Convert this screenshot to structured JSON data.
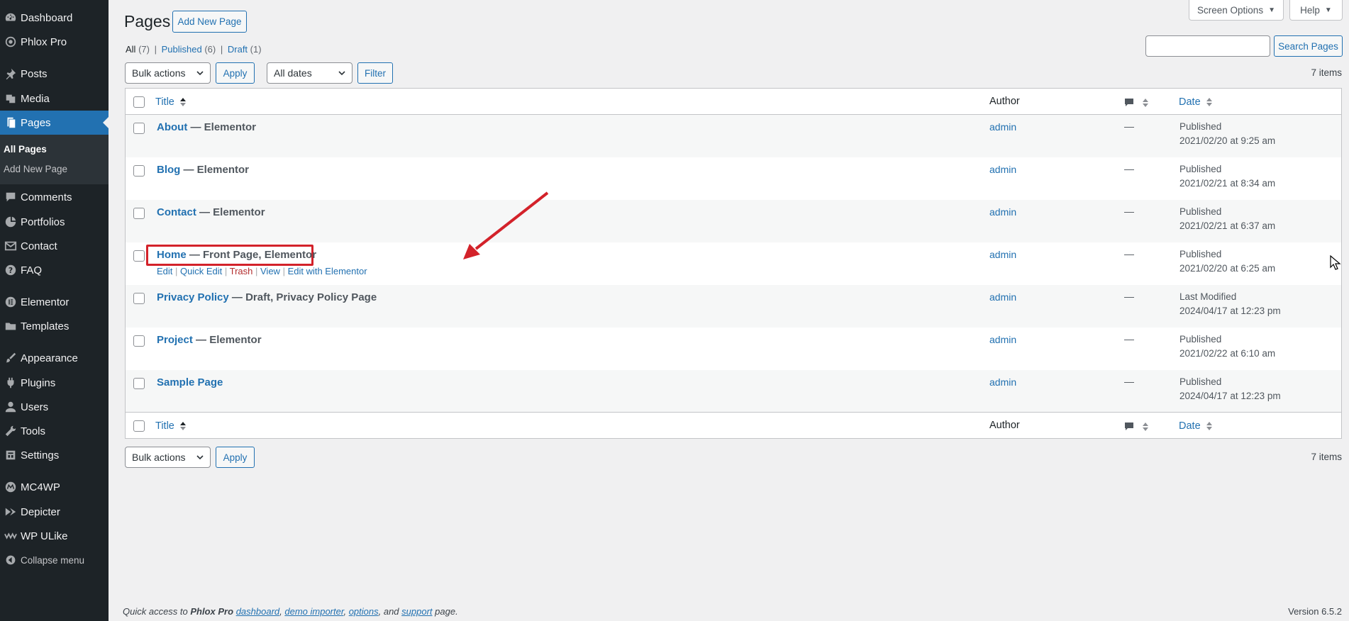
{
  "sidebar": {
    "items": [
      {
        "label": "Dashboard",
        "icon": "dashboard-icon"
      },
      {
        "label": "Phlox Pro",
        "icon": "phlox-icon"
      },
      {
        "label": "Posts",
        "icon": "pin-icon"
      },
      {
        "label": "Media",
        "icon": "media-icon"
      },
      {
        "label": "Pages",
        "icon": "pages-icon"
      },
      {
        "label": "Comments",
        "icon": "comment-icon"
      },
      {
        "label": "Portfolios",
        "icon": "portfolio-icon"
      },
      {
        "label": "Contact",
        "icon": "mail-icon"
      },
      {
        "label": "FAQ",
        "icon": "help-icon"
      },
      {
        "label": "Elementor",
        "icon": "elementor-icon"
      },
      {
        "label": "Templates",
        "icon": "folder-icon"
      },
      {
        "label": "Appearance",
        "icon": "brush-icon"
      },
      {
        "label": "Plugins",
        "icon": "plugin-icon"
      },
      {
        "label": "Users",
        "icon": "users-icon"
      },
      {
        "label": "Tools",
        "icon": "wrench-icon"
      },
      {
        "label": "Settings",
        "icon": "settings-icon"
      },
      {
        "label": "MC4WP",
        "icon": "mc4wp-icon"
      },
      {
        "label": "Depicter",
        "icon": "depicter-icon"
      },
      {
        "label": "WP ULike",
        "icon": "ulike-icon"
      }
    ],
    "submenu": [
      "All Pages",
      "Add New Page"
    ],
    "collapse_label": "Collapse menu"
  },
  "header": {
    "title": "Pages",
    "add_new": "Add New Page",
    "screen_options": "Screen Options",
    "help": "Help",
    "search_button": "Search Pages",
    "search_value": ""
  },
  "filters": {
    "all": "All",
    "all_count": "(7)",
    "published": "Published",
    "published_count": "(6)",
    "draft": "Draft",
    "draft_count": "(1)",
    "separator": "|"
  },
  "toolbar": {
    "bulk_actions": "Bulk actions",
    "apply": "Apply",
    "all_dates": "All dates",
    "filter": "Filter",
    "items_count": "7 items"
  },
  "table": {
    "columns": {
      "title": "Title",
      "author": "Author",
      "date": "Date"
    },
    "rows": [
      {
        "title": "About",
        "state": " — Elementor",
        "author": "admin",
        "comments": "—",
        "status": "Published",
        "datetime": "2021/02/20 at 9:25 am"
      },
      {
        "title": "Blog",
        "state": " — Elementor",
        "author": "admin",
        "comments": "—",
        "status": "Published",
        "datetime": "2021/02/21 at 8:34 am"
      },
      {
        "title": "Contact",
        "state": " — Elementor",
        "author": "admin",
        "comments": "—",
        "status": "Published",
        "datetime": "2021/02/21 at 6:37 am"
      },
      {
        "title": "Home",
        "state": " — Front Page, Elementor",
        "author": "admin",
        "comments": "—",
        "status": "Published",
        "datetime": "2021/02/20 at 6:25 am"
      },
      {
        "title": "Privacy Policy",
        "state": " — Draft, Privacy Policy Page",
        "author": "admin",
        "comments": "—",
        "status": "Last Modified",
        "datetime": "2024/04/17 at 12:23 pm"
      },
      {
        "title": "Project",
        "state": " — Elementor",
        "author": "admin",
        "comments": "—",
        "status": "Published",
        "datetime": "2021/02/22 at 6:10 am"
      },
      {
        "title": "Sample Page",
        "state": "",
        "author": "admin",
        "comments": "—",
        "status": "Published",
        "datetime": "2024/04/17 at 12:23 pm"
      }
    ],
    "row_actions": {
      "edit": "Edit",
      "quick_edit": "Quick Edit",
      "trash": "Trash",
      "view": "View",
      "edit_elementor": "Edit with Elementor"
    }
  },
  "footer": {
    "prefix": "Quick access to ",
    "brand": "Phlox Pro",
    "links": [
      "dashboard",
      "demo importer",
      "options",
      "support"
    ],
    "suffix": " page.",
    "and": ", and ",
    "comma": ", ",
    "version": "Version 6.5.2"
  },
  "colors": {
    "sidebar_bg": "#1d2327",
    "accent": "#2271b1",
    "highlight_box": "#d3222a",
    "trash": "#b32d2e"
  }
}
